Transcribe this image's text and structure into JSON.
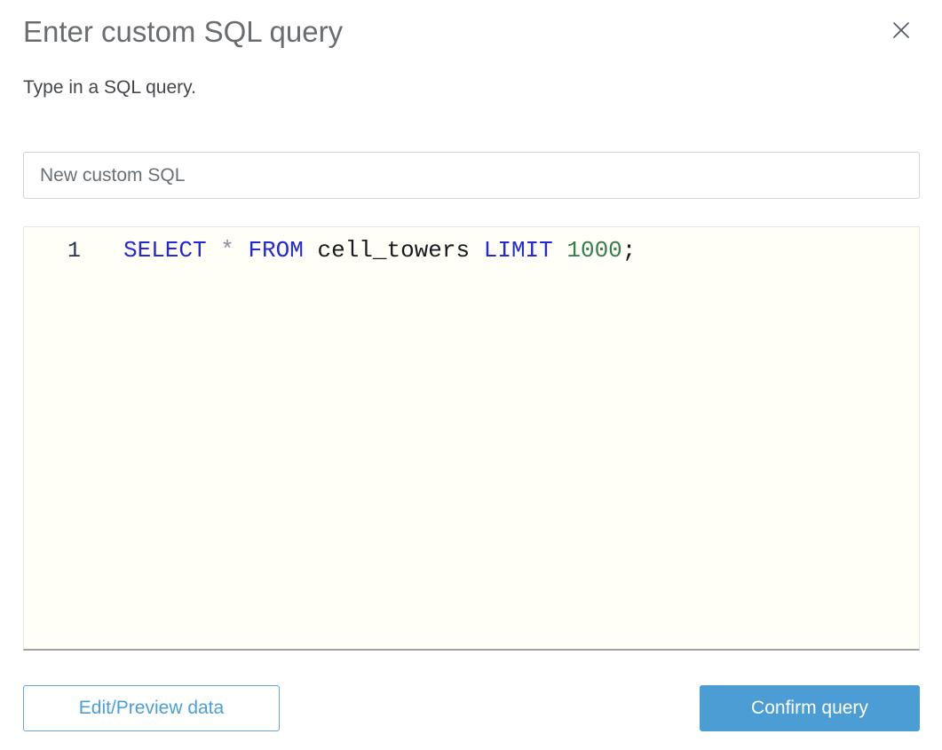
{
  "header": {
    "title": "Enter custom SQL query",
    "close_icon": "x-mark"
  },
  "subtitle": "Type in a SQL query.",
  "name_input": {
    "value": "New custom SQL"
  },
  "editor": {
    "line_number": "1",
    "line": {
      "tokens": [
        {
          "text": "SELECT",
          "type": "keyword"
        },
        {
          "text": " ",
          "type": "plain"
        },
        {
          "text": "*",
          "type": "operator"
        },
        {
          "text": " ",
          "type": "plain"
        },
        {
          "text": "FROM",
          "type": "keyword"
        },
        {
          "text": " ",
          "type": "plain"
        },
        {
          "text": "cell_towers",
          "type": "identifier"
        },
        {
          "text": " ",
          "type": "plain"
        },
        {
          "text": "LIMIT",
          "type": "keyword"
        },
        {
          "text": " ",
          "type": "plain"
        },
        {
          "text": "1000",
          "type": "number"
        },
        {
          "text": ";",
          "type": "punctuation"
        }
      ]
    }
  },
  "footer": {
    "edit_preview_label": "Edit/Preview data",
    "confirm_label": "Confirm query"
  },
  "colors": {
    "title_gray": "#6a6d70",
    "accent_blue": "#4c9dd4",
    "keyword_blue": "#2329d6",
    "number_green": "#377d4e",
    "operator_gray": "#8a90a0",
    "editor_background": "#fffef7",
    "input_border": "#d3d6d8"
  }
}
